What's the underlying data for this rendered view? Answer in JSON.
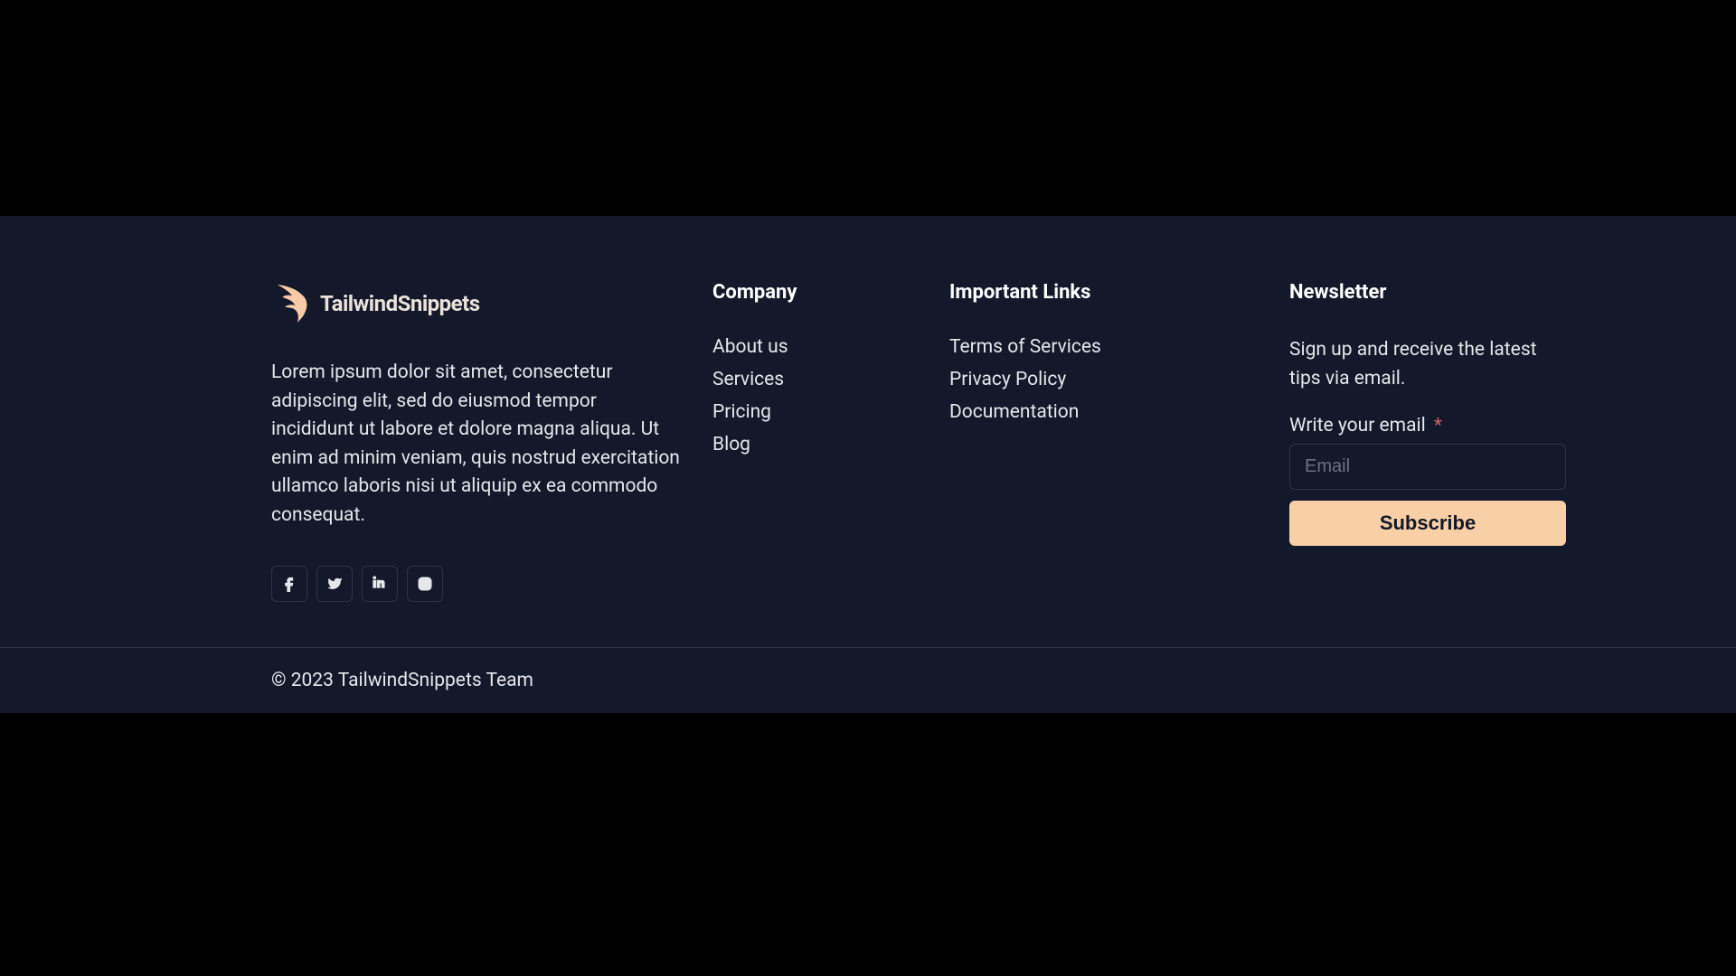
{
  "brand": {
    "name": "TailwindSnippets",
    "description": "Lorem ipsum dolor sit amet, consectetur adipiscing elit, sed do eiusmod tempor incididunt ut labore et dolore magna aliqua. Ut enim ad minim veniam, quis nostrud exercitation ullamco laboris nisi ut aliquip ex ea commodo consequat."
  },
  "socials": [
    "facebook",
    "twitter",
    "linkedin",
    "instagram"
  ],
  "company": {
    "title": "Company",
    "links": [
      "About us",
      "Services",
      "Pricing",
      "Blog"
    ]
  },
  "important": {
    "title": "Important Links",
    "links": [
      "Terms of Services",
      "Privacy Policy",
      "Documentation"
    ]
  },
  "newsletter": {
    "title": "Newsletter",
    "description": "Sign up and receive the latest tips via email.",
    "label": "Write your email",
    "required": "*",
    "placeholder": "Email",
    "button": "Subscribe"
  },
  "copyright": "© 2023 TailwindSnippets Team"
}
